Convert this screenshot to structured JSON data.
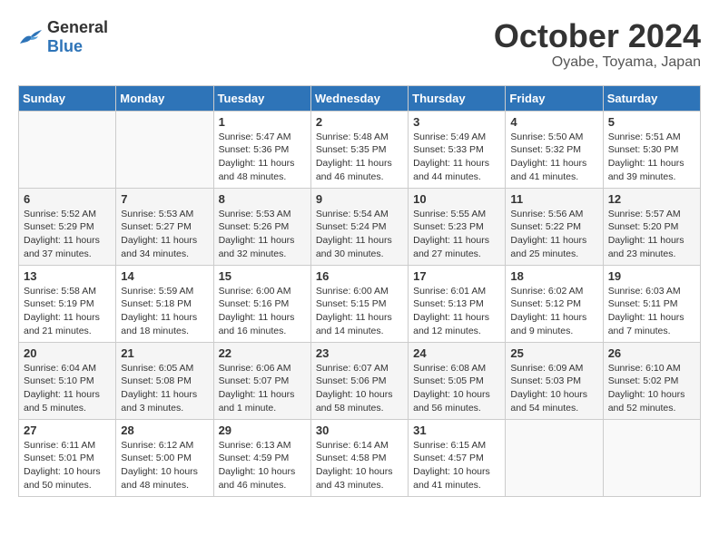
{
  "header": {
    "logo_general": "General",
    "logo_blue": "Blue",
    "month": "October 2024",
    "location": "Oyabe, Toyama, Japan"
  },
  "calendar": {
    "headers": [
      "Sunday",
      "Monday",
      "Tuesday",
      "Wednesday",
      "Thursday",
      "Friday",
      "Saturday"
    ],
    "weeks": [
      [
        {
          "day": "",
          "detail": ""
        },
        {
          "day": "",
          "detail": ""
        },
        {
          "day": "1",
          "detail": "Sunrise: 5:47 AM\nSunset: 5:36 PM\nDaylight: 11 hours and 48 minutes."
        },
        {
          "day": "2",
          "detail": "Sunrise: 5:48 AM\nSunset: 5:35 PM\nDaylight: 11 hours and 46 minutes."
        },
        {
          "day": "3",
          "detail": "Sunrise: 5:49 AM\nSunset: 5:33 PM\nDaylight: 11 hours and 44 minutes."
        },
        {
          "day": "4",
          "detail": "Sunrise: 5:50 AM\nSunset: 5:32 PM\nDaylight: 11 hours and 41 minutes."
        },
        {
          "day": "5",
          "detail": "Sunrise: 5:51 AM\nSunset: 5:30 PM\nDaylight: 11 hours and 39 minutes."
        }
      ],
      [
        {
          "day": "6",
          "detail": "Sunrise: 5:52 AM\nSunset: 5:29 PM\nDaylight: 11 hours and 37 minutes."
        },
        {
          "day": "7",
          "detail": "Sunrise: 5:53 AM\nSunset: 5:27 PM\nDaylight: 11 hours and 34 minutes."
        },
        {
          "day": "8",
          "detail": "Sunrise: 5:53 AM\nSunset: 5:26 PM\nDaylight: 11 hours and 32 minutes."
        },
        {
          "day": "9",
          "detail": "Sunrise: 5:54 AM\nSunset: 5:24 PM\nDaylight: 11 hours and 30 minutes."
        },
        {
          "day": "10",
          "detail": "Sunrise: 5:55 AM\nSunset: 5:23 PM\nDaylight: 11 hours and 27 minutes."
        },
        {
          "day": "11",
          "detail": "Sunrise: 5:56 AM\nSunset: 5:22 PM\nDaylight: 11 hours and 25 minutes."
        },
        {
          "day": "12",
          "detail": "Sunrise: 5:57 AM\nSunset: 5:20 PM\nDaylight: 11 hours and 23 minutes."
        }
      ],
      [
        {
          "day": "13",
          "detail": "Sunrise: 5:58 AM\nSunset: 5:19 PM\nDaylight: 11 hours and 21 minutes."
        },
        {
          "day": "14",
          "detail": "Sunrise: 5:59 AM\nSunset: 5:18 PM\nDaylight: 11 hours and 18 minutes."
        },
        {
          "day": "15",
          "detail": "Sunrise: 6:00 AM\nSunset: 5:16 PM\nDaylight: 11 hours and 16 minutes."
        },
        {
          "day": "16",
          "detail": "Sunrise: 6:00 AM\nSunset: 5:15 PM\nDaylight: 11 hours and 14 minutes."
        },
        {
          "day": "17",
          "detail": "Sunrise: 6:01 AM\nSunset: 5:13 PM\nDaylight: 11 hours and 12 minutes."
        },
        {
          "day": "18",
          "detail": "Sunrise: 6:02 AM\nSunset: 5:12 PM\nDaylight: 11 hours and 9 minutes."
        },
        {
          "day": "19",
          "detail": "Sunrise: 6:03 AM\nSunset: 5:11 PM\nDaylight: 11 hours and 7 minutes."
        }
      ],
      [
        {
          "day": "20",
          "detail": "Sunrise: 6:04 AM\nSunset: 5:10 PM\nDaylight: 11 hours and 5 minutes."
        },
        {
          "day": "21",
          "detail": "Sunrise: 6:05 AM\nSunset: 5:08 PM\nDaylight: 11 hours and 3 minutes."
        },
        {
          "day": "22",
          "detail": "Sunrise: 6:06 AM\nSunset: 5:07 PM\nDaylight: 11 hours and 1 minute."
        },
        {
          "day": "23",
          "detail": "Sunrise: 6:07 AM\nSunset: 5:06 PM\nDaylight: 10 hours and 58 minutes."
        },
        {
          "day": "24",
          "detail": "Sunrise: 6:08 AM\nSunset: 5:05 PM\nDaylight: 10 hours and 56 minutes."
        },
        {
          "day": "25",
          "detail": "Sunrise: 6:09 AM\nSunset: 5:03 PM\nDaylight: 10 hours and 54 minutes."
        },
        {
          "day": "26",
          "detail": "Sunrise: 6:10 AM\nSunset: 5:02 PM\nDaylight: 10 hours and 52 minutes."
        }
      ],
      [
        {
          "day": "27",
          "detail": "Sunrise: 6:11 AM\nSunset: 5:01 PM\nDaylight: 10 hours and 50 minutes."
        },
        {
          "day": "28",
          "detail": "Sunrise: 6:12 AM\nSunset: 5:00 PM\nDaylight: 10 hours and 48 minutes."
        },
        {
          "day": "29",
          "detail": "Sunrise: 6:13 AM\nSunset: 4:59 PM\nDaylight: 10 hours and 46 minutes."
        },
        {
          "day": "30",
          "detail": "Sunrise: 6:14 AM\nSunset: 4:58 PM\nDaylight: 10 hours and 43 minutes."
        },
        {
          "day": "31",
          "detail": "Sunrise: 6:15 AM\nSunset: 4:57 PM\nDaylight: 10 hours and 41 minutes."
        },
        {
          "day": "",
          "detail": ""
        },
        {
          "day": "",
          "detail": ""
        }
      ]
    ]
  }
}
